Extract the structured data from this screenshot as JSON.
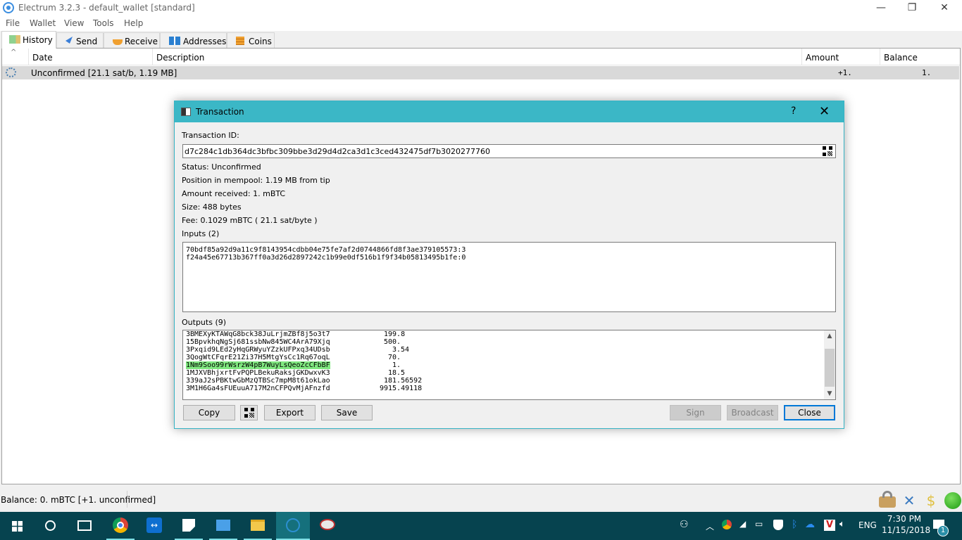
{
  "window": {
    "title": "Electrum 3.2.3  -  default_wallet  [standard]",
    "minimize": "—",
    "maximize": "❐",
    "close": "✕"
  },
  "menu": [
    "File",
    "Wallet",
    "View",
    "Tools",
    "Help"
  ],
  "tabs": [
    {
      "label": "History",
      "icon": "history-icon",
      "active": true
    },
    {
      "label": "Send",
      "icon": "send-icon",
      "active": false
    },
    {
      "label": "Receive",
      "icon": "receive-icon",
      "active": false
    },
    {
      "label": "Addresses",
      "icon": "addresses-icon",
      "active": false
    },
    {
      "label": "Coins",
      "icon": "coins-icon",
      "active": false
    }
  ],
  "history": {
    "sort_indicator": "^",
    "columns": [
      "Date",
      "Description",
      "Amount",
      "Balance"
    ],
    "rows": [
      {
        "status_icon": "unconfirmed-gears-icon",
        "date": "Unconfirmed [21.1 sat/b, 1.19 MB]",
        "description": "",
        "amount": "+1.",
        "balance": "1."
      }
    ]
  },
  "dialog": {
    "title": "Transaction",
    "help": "?",
    "close": "✕",
    "txid_label": "Transaction ID:",
    "txid": "d7c284c1db364dc3bfbc309bbe3d29d4d2ca3d1c3ced432475df7b3020277760",
    "status": "Status: Unconfirmed",
    "mempool": "Position in mempool: 1.19 MB from tip",
    "amount": "Amount received: 1. mBTC",
    "size": "Size: 488 bytes",
    "fee": "Fee: 0.1029 mBTC  ( 21.1 sat/byte )",
    "inputs_label": "Inputs (2)",
    "inputs": [
      "70bdf85a92d9a11c9f8143954cdbb04e75fe7af2d0744866fd8f3ae379105573:3",
      "f24a45e67713b367ff0a3d26d2897242c1b99e0df516b1f9f34b05813495b1fe:0"
    ],
    "outputs_label": "Outputs (9)",
    "outputs": [
      {
        "address": "3BMEXyKTAWqG8bck38JuLrjmZBf8j5o3t7",
        "amount": "199.8",
        "mine": false
      },
      {
        "address": "15BpvkhqNgSj681ssbNw845WC4ArA79Xjq",
        "amount": "500.",
        "mine": false
      },
      {
        "address": "3Pxqid9LEd2yHqGRWyuYZzkUFPxq34UDsb",
        "amount": "3.54",
        "mine": false
      },
      {
        "address": "3QogWtCFqrE21Zi37H5MtgYsCc1Rq67oqL",
        "amount": "70.",
        "mine": false
      },
      {
        "address": "1Nm9Soo99rWsrzW4pB7WuyLsQeoZcCFbBF",
        "amount": "1.",
        "mine": true
      },
      {
        "address": "1MJXVBhjxrtFvPQPLBekuRaksjGKDwxvK3",
        "amount": "18.5",
        "mine": false
      },
      {
        "address": "339aJ2sPBKtwGbMzQTBSc7mpM8t61okLao",
        "amount": "181.56592",
        "mine": false
      },
      {
        "address": "3M1H6Ga4sFUEuuA717M2nCFPQvMjAFnzfd",
        "amount": "9915.49118",
        "mine": false
      }
    ],
    "buttons": {
      "copy": "Copy",
      "export": "Export",
      "save": "Save",
      "sign": "Sign",
      "broadcast": "Broadcast",
      "close": "Close"
    },
    "highlight_color": "#80e880"
  },
  "statusbar": {
    "balance": "Balance: 0. mBTC  [+1. unconfirmed]",
    "icons": [
      "lock-icon",
      "preferences-icon",
      "seed-icon",
      "network-status-icon"
    ]
  },
  "taskbar": {
    "apps": [
      "start-icon",
      "search-icon",
      "task-view-icon",
      "chrome-icon",
      "teamviewer-icon",
      "sticky-icon",
      "control-panel-icon",
      "file-explorer-icon",
      "electrum-icon",
      "snipping-tool-icon"
    ],
    "language": "ENG",
    "time": "7:30 PM",
    "date": "11/15/2018",
    "notifications": "1"
  }
}
